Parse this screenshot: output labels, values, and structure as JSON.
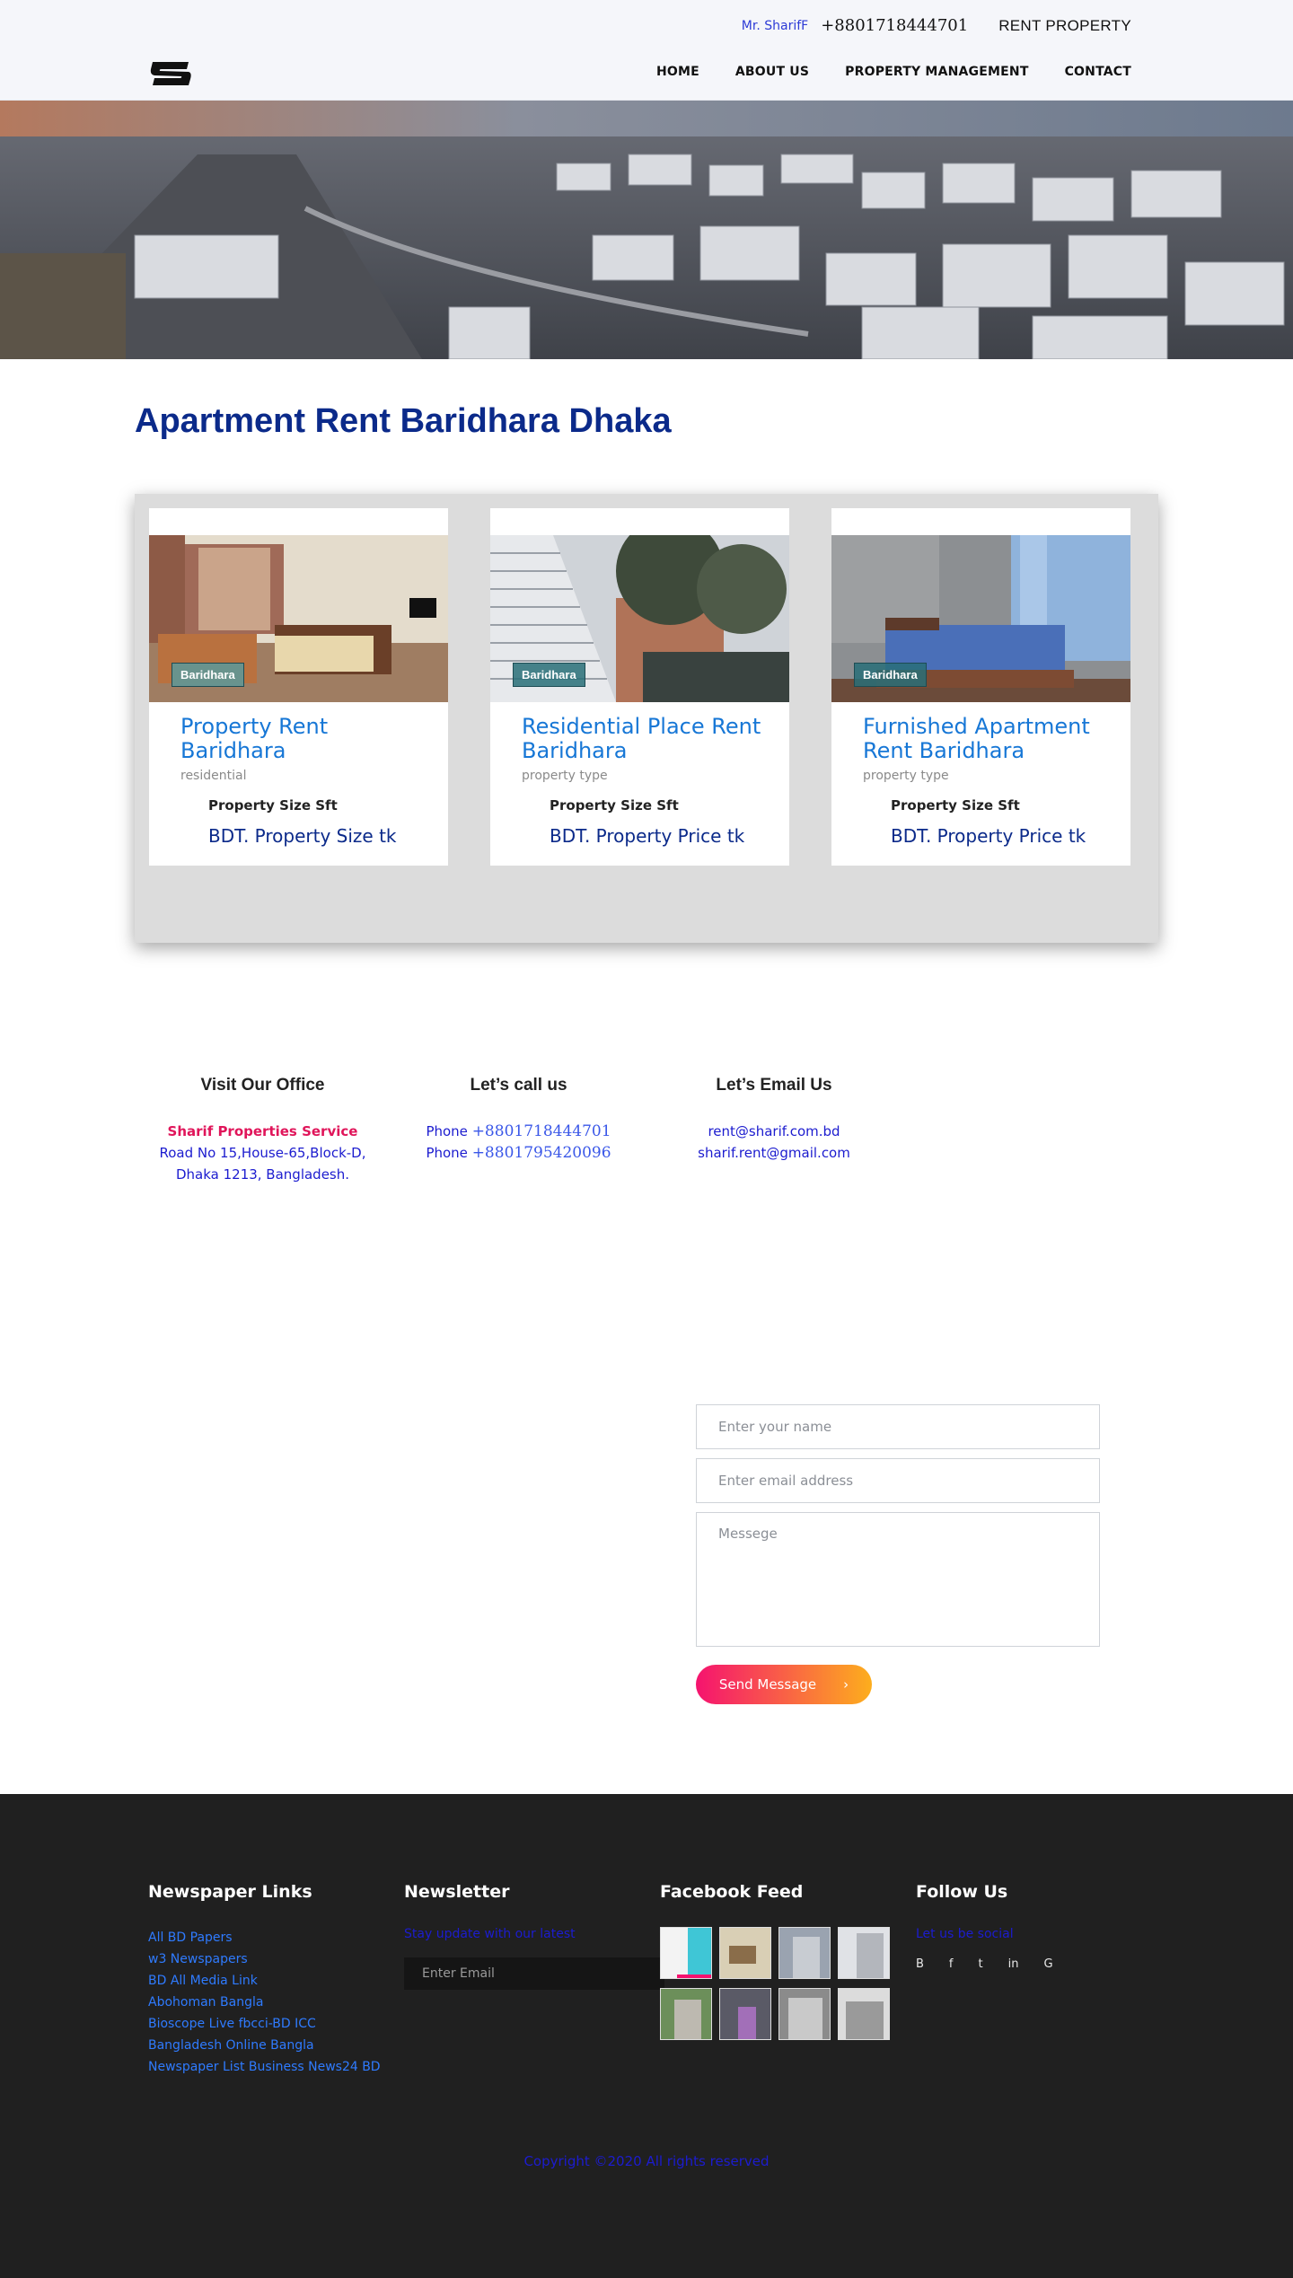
{
  "header": {
    "contact_name": "Mr. SharifF",
    "phone": "+8801718444701",
    "brand": "RENT PROPERTY",
    "nav": [
      "HOME",
      "ABOUT US",
      "PROPERTY MANAGEMENT",
      "CONTACT"
    ]
  },
  "main": {
    "title": "Apartment Rent Baridhara Dhaka"
  },
  "listings": [
    {
      "badge": "Baridhara",
      "title": "Property Rent Baridhara",
      "type": "residential",
      "size": "Property Size Sft",
      "price": "BDT. Property Size tk"
    },
    {
      "badge": "Baridhara",
      "title": "Residential Place Rent Baridhara",
      "type": "property type",
      "size": "Property Size Sft",
      "price": "BDT. Property Price tk"
    },
    {
      "badge": "Baridhara",
      "title": "Furnished Apartment Rent Baridhara",
      "type": "property type",
      "size": "Property Size Sft",
      "price": "BDT. Property Price tk"
    }
  ],
  "contact": {
    "office": {
      "heading": "Visit Our Office",
      "company": "Sharif Properties Service",
      "address1": "Road No 15,House-65,Block-D,",
      "address2": "Dhaka 1213, Bangladesh."
    },
    "call": {
      "heading": "Let’s call us",
      "label": "Phone",
      "phone1": "+8801718444701",
      "phone2": "+8801795420096"
    },
    "email": {
      "heading": "Let’s Email Us",
      "email1": "rent@sharif.com.bd",
      "email2": "sharif.rent@gmail.com"
    }
  },
  "form": {
    "name_placeholder": "Enter your name",
    "email_placeholder": "Enter email address",
    "message_placeholder": "Messege",
    "send_label": "Send Message",
    "send_icon": "arrow-icon"
  },
  "footer": {
    "newspaper": {
      "heading": "Newspaper Links",
      "links": [
        "All BD Papers",
        "w3 Newspapers",
        "BD All Media Link",
        "Abohoman Bangla",
        "Bioscope Live fbcci-BD ICC",
        "Bangladesh Online Bangla",
        "Newspaper List Business News24 BD"
      ]
    },
    "newsletter": {
      "heading": "Newsletter",
      "text": "Stay update with our latest",
      "placeholder": "Enter Email"
    },
    "facebook": {
      "heading": "Facebook Feed"
    },
    "follow": {
      "heading": "Follow Us",
      "text": "Let us be social",
      "socials": [
        "B",
        "f",
        "t",
        "in",
        "G"
      ]
    },
    "copyright": "Copyright ©2020 All rights reserved"
  },
  "colors": {
    "brand_blue": "#0b2a8a",
    "link_blue": "#1777d6",
    "accent_pink": "#f5136f",
    "accent_orange": "#fdae1d",
    "footer_bg": "#202020"
  }
}
